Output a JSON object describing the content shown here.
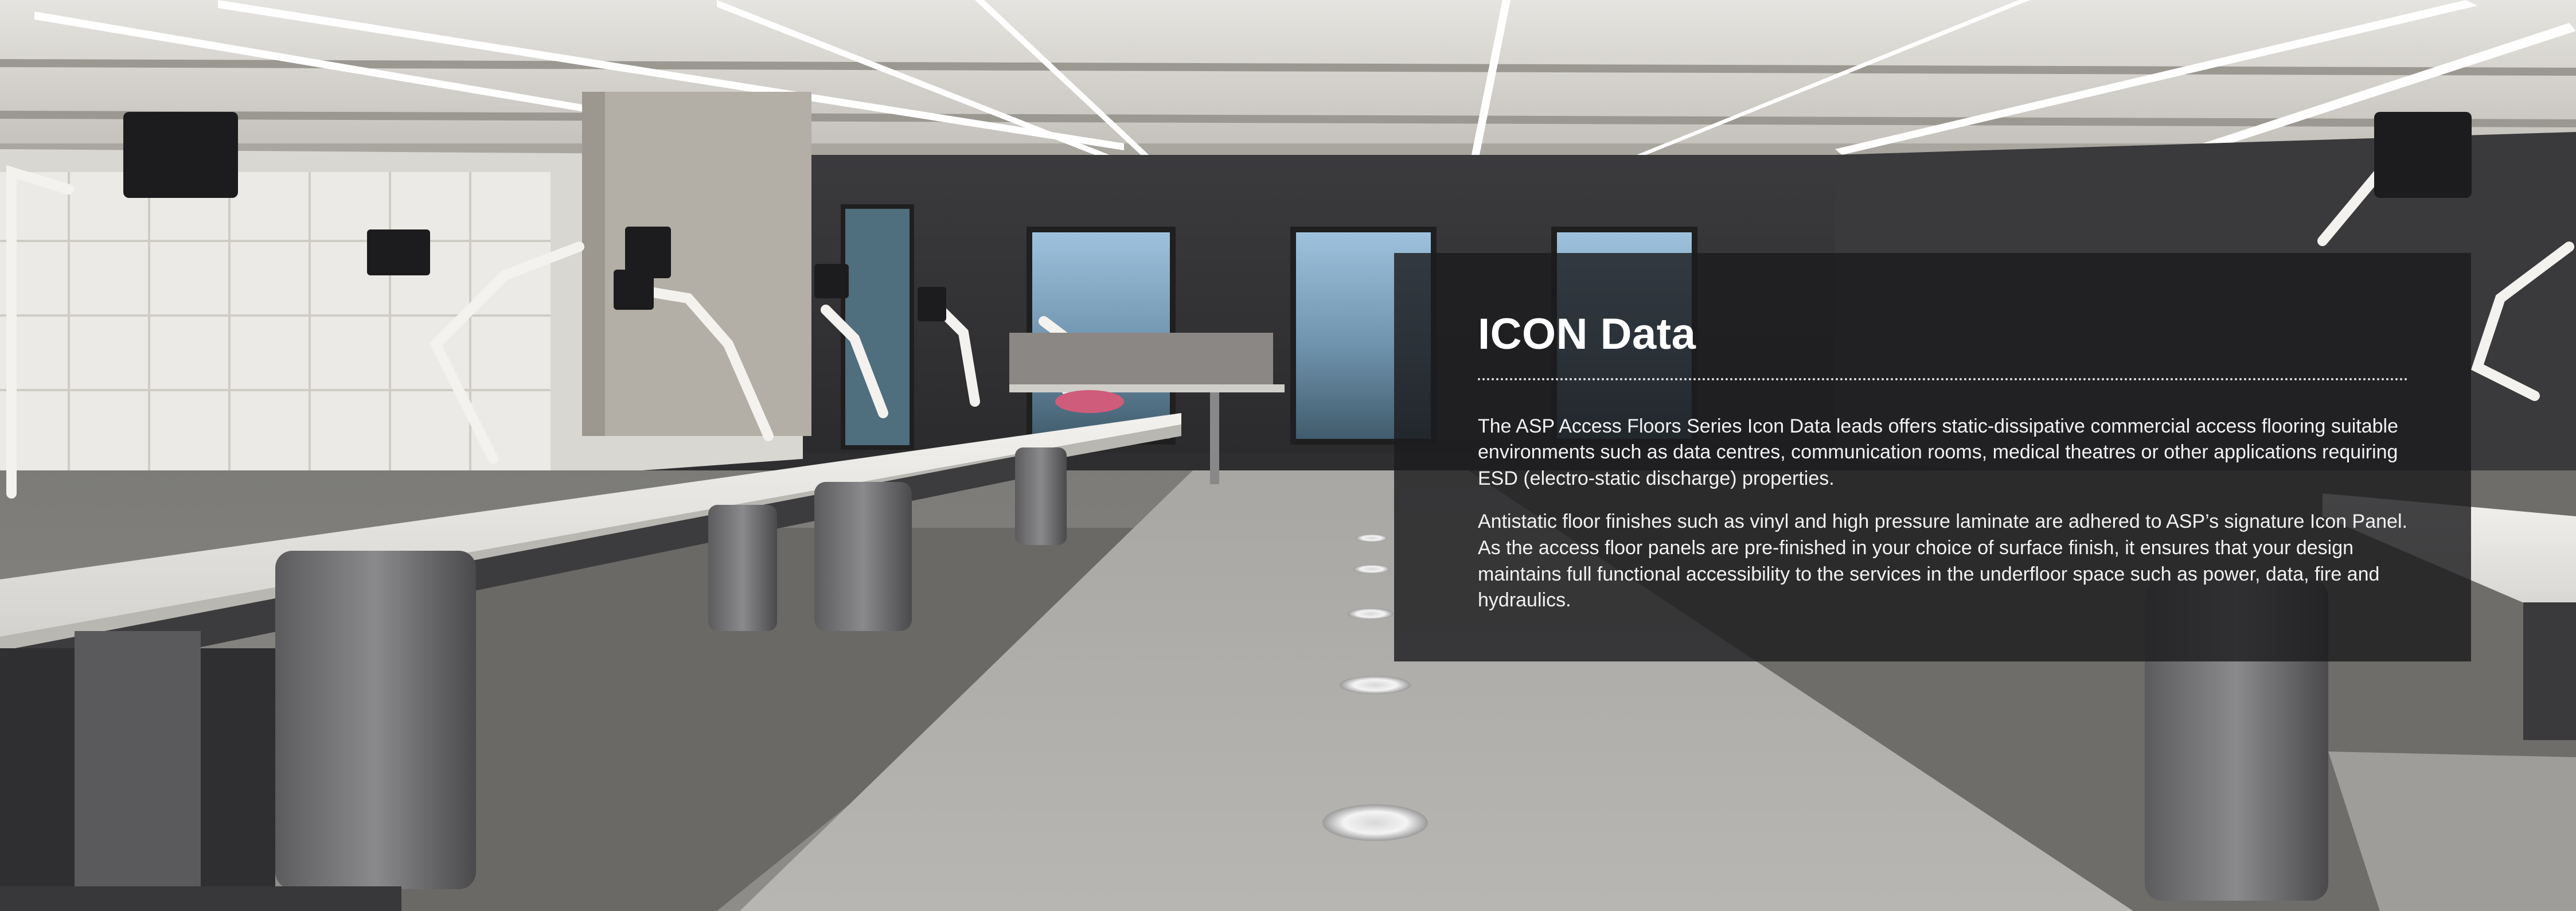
{
  "overlay": {
    "title": "ICON Data",
    "paragraphs": [
      "The ASP Access Floors Series Icon Data leads offers static-dissipative commercial access flooring suitable environments such as data centres, communication rooms, medical theatres or other applications requiring ESD (electro-static discharge) properties.",
      "Antistatic floor finishes such as vinyl and high pressure laminate are adhered to ASP’s signature Icon Panel. As the access floor panels are pre-finished in your choice of surface finish, it ensures that your design maintains full functional accessibility to the services in the underfloor space such as power, data, fire and hydraulics."
    ]
  },
  "colors": {
    "panel_background": "#1c1c1e",
    "text": "#ffffff",
    "carpet": "#8e8c88",
    "ceiling": "#d8d6d2"
  },
  "icons": {
    "monitor_mount": "monitor-mount-icon",
    "floor_vent": "floor-vent-icon"
  }
}
